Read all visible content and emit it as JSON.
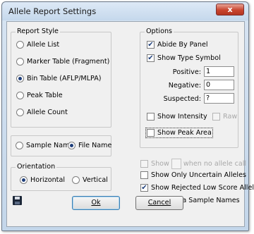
{
  "window": {
    "title": "Allele Report Settings",
    "close_glyph": "x"
  },
  "report_style": {
    "legend": "Report Style",
    "options": [
      {
        "label": "Allele List",
        "selected": false
      },
      {
        "label": "Marker Table (Fragment)",
        "selected": false
      },
      {
        "label": "Bin Table (AFLP/MLPA)",
        "selected": true
      },
      {
        "label": "Peak Table",
        "selected": false
      },
      {
        "label": "Allele Count",
        "selected": false
      }
    ]
  },
  "name_by": {
    "sample_name": "Sample Name",
    "file_name": "File Name",
    "selected": "File Name"
  },
  "orientation": {
    "legend": "Orientation",
    "horizontal": "Horizontal",
    "vertical": "Vertical",
    "selected": "Horizontal"
  },
  "options": {
    "legend": "Options",
    "abide_by_panel": {
      "label": "Abide By Panel",
      "checked": true
    },
    "show_type_symbol": {
      "label": "Show Type Symbol",
      "checked": true
    },
    "positive": {
      "label": "Positive:",
      "value": "1"
    },
    "negative": {
      "label": "Negative:",
      "value": "0"
    },
    "suspected": {
      "label": "Suspected:",
      "value": "?"
    },
    "show_intensity": {
      "label": "Show Intensity",
      "checked": false
    },
    "raw": {
      "label": "Raw",
      "checked": false,
      "enabled": false
    },
    "show_peak_area": {
      "label": "Show Peak Area",
      "checked": false
    }
  },
  "extra": {
    "show_prefix": "Show",
    "show_suffix": "when no allele call",
    "show_only_uncertain": {
      "label": "Show Only Uncertain Alleles",
      "checked": false
    },
    "show_rejected": {
      "label": "Show Rejected Low Score Alleles",
      "checked": true
    },
    "hide_extra_names": {
      "label": "Hide Extra Sample Names",
      "checked": true
    }
  },
  "buttons": {
    "ok": "Ok",
    "cancel": "Cancel"
  },
  "icons": {
    "save": "floppy-disk-icon",
    "check": "✔"
  }
}
